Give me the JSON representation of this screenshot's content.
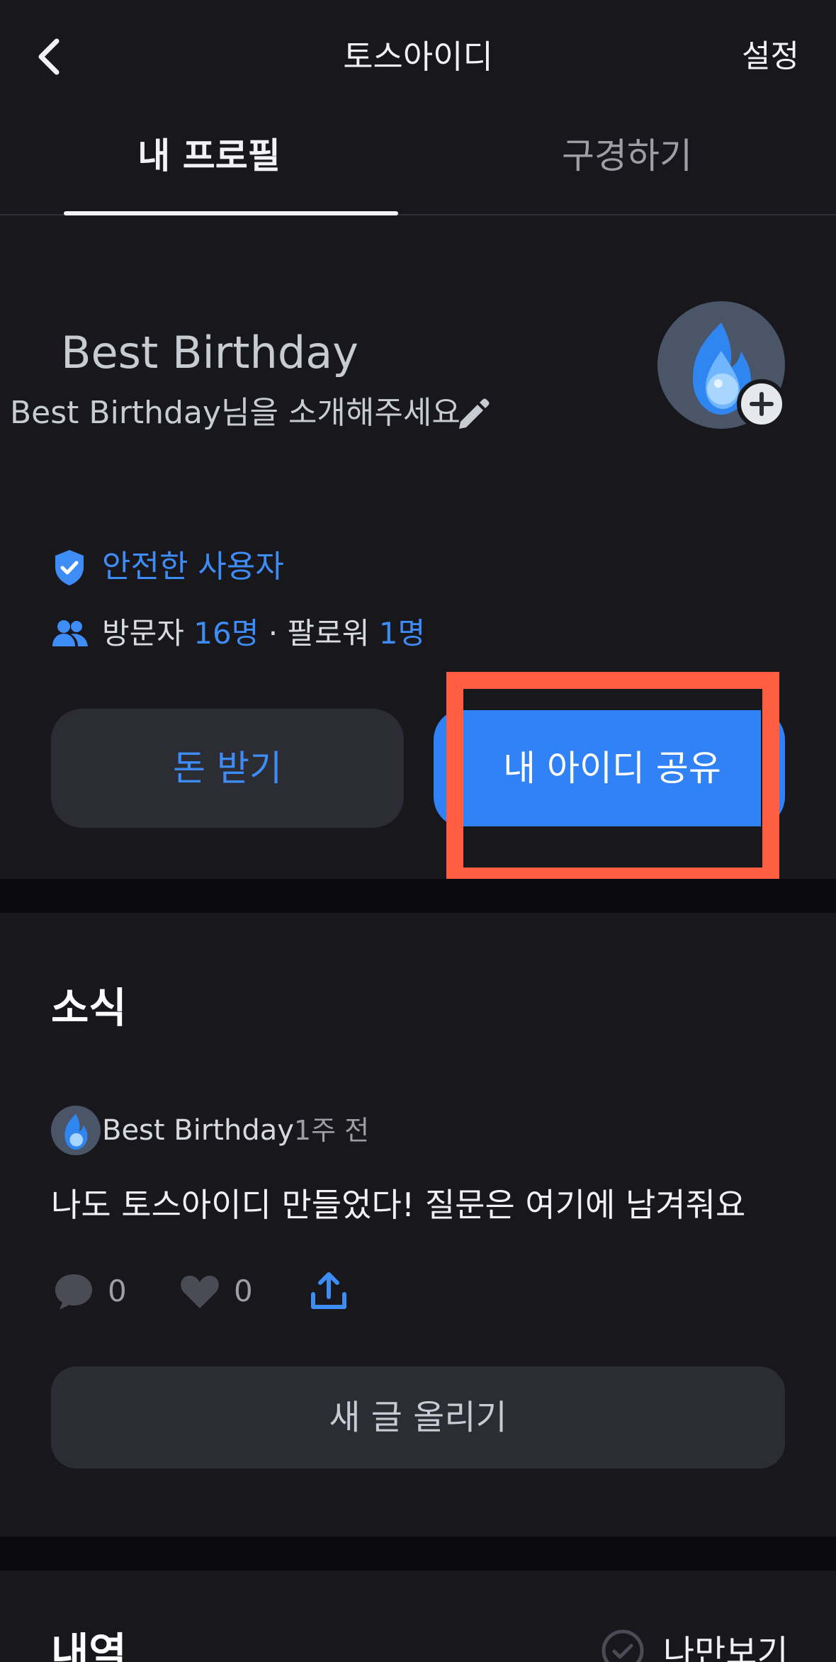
{
  "header": {
    "title": "토스아이디",
    "settings_label": "설정"
  },
  "tabs": [
    {
      "label": "내 프로필",
      "active": true
    },
    {
      "label": "구경하기",
      "active": false
    }
  ],
  "profile": {
    "name": "Best Birthday",
    "intro_prompt": "Best Birthday님을 소개해주세요",
    "safe_user_label": "안전한 사용자",
    "stats": {
      "visitors_label": "방문자",
      "visitors_count": "16명",
      "separator": "·",
      "followers_label": "팔로워",
      "followers_count": "1명"
    }
  },
  "actions": {
    "receive_money_label": "돈 받기",
    "share_id_label": "내 아이디 공유"
  },
  "news": {
    "section_title": "소식",
    "post": {
      "author": "Best Birthday",
      "time": "1주 전",
      "body": "나도 토스아이디 만들었다! 질문은 여기에 남겨줘요",
      "comment_count": "0",
      "like_count": "0"
    },
    "new_post_label": "새 글 올리기"
  },
  "history": {
    "section_title": "내역",
    "only_me_label": "나만보기"
  },
  "colors": {
    "background": "#17171c",
    "accent_blue": "#3182f6",
    "highlight": "#ff5e43",
    "card": "#2c2c35"
  }
}
